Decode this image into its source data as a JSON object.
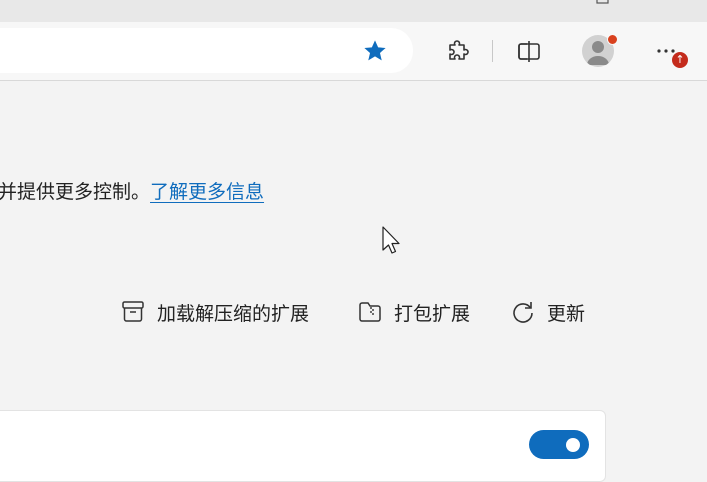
{
  "toolbar": {
    "favorite_icon": "star-filled-icon",
    "extensions_icon": "puzzle-icon",
    "split_screen_icon": "split-screen-icon",
    "profile_icon": "avatar-icon",
    "more_icon": "ellipsis-icon",
    "update_badge": "↑",
    "accent": "#0f6cbd"
  },
  "main": {
    "description": "并提供更多控制。",
    "learn_more_link": "了解更多信息"
  },
  "actions": {
    "load_unpacked": "加载解压缩的扩展",
    "pack": "打包扩展",
    "update": "更新"
  },
  "card": {
    "toggle_state": "on"
  }
}
